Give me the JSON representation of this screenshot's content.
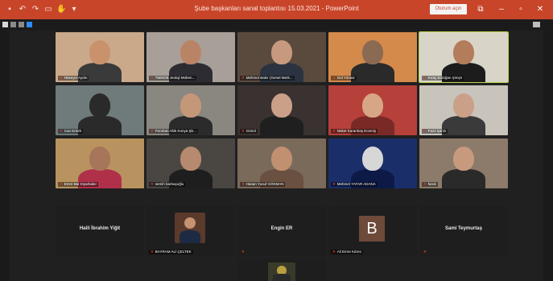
{
  "titlebar": {
    "title": "Şube başkanları sanal toplantısı 15.03.2021 - PowerPoint",
    "signin": "Oturum açın",
    "quick": [
      "save-icon",
      "undo-icon",
      "redo-icon",
      "start-presentation-icon",
      "touch-mode-icon",
      "customize-icon"
    ],
    "window_controls": [
      "ribbon-options-icon",
      "minimize-icon",
      "maximize-icon",
      "close-icon"
    ],
    "bg": "#c8452a"
  },
  "participants": [
    {
      "name": "Hüseyin Aydın",
      "bg": "#c9a98a",
      "skin": "#c9926c",
      "shirt": "#3a3a3a"
    },
    {
      "name": "TMMOB Jeoloji Mühen...",
      "bg": "#a8a098",
      "skin": "#b98466",
      "shirt": "#2e2c33"
    },
    {
      "name": "Mehmet Bakır (Genel Merk...",
      "bg": "#5a4a3e",
      "skin": "#c79a7f",
      "shirt": "#2b3340"
    },
    {
      "name": "Gül Yılmaz",
      "bg": "#d48a4a",
      "skin": "#8a6a52",
      "shirt": "#2a2a2a"
    },
    {
      "name": "Kıraç Erdoğan Şimşir",
      "bg": "#d9d4c8",
      "skin": "#b37c5a",
      "shirt": "#1c1c1c",
      "active": true
    },
    {
      "name": "Can Ertürk",
      "bg": "#6f7a7a",
      "skin": "#2a2a2a",
      "shirt": "#2a2a2a"
    },
    {
      "name": "Feruhan Altık Konya Şb...",
      "bg": "#8a8680",
      "skin": "#c59779",
      "shirt": "#2b2b2b"
    },
    {
      "name": "Gönül",
      "bg": "#3a3230",
      "skin": "#caa088",
      "shirt": "#1f1f1f"
    },
    {
      "name": "Nüket Karanbaş Ecemiş",
      "bg": "#b6403a",
      "skin": "#d6a686",
      "shirt": "#7a2a26"
    },
    {
      "name": "Fazıl Şahin",
      "bg": "#c8c4bc",
      "skin": "#caa088",
      "shirt": "#3a3a3a"
    },
    {
      "name": "Emre Bal Diyarbakır",
      "bg": "#b8935f",
      "skin": "#a7755a",
      "shirt": "#b0304a"
    },
    {
      "name": "semih barbaşoğlu",
      "bg": "#4a4642",
      "skin": "#b68a6e",
      "shirt": "#1e1e1e"
    },
    {
      "name": "Hasan Yusuf GÖKMAN",
      "bg": "#7a6a5a",
      "skin": "#c09070",
      "shirt": "#6a5040"
    },
    {
      "name": "Mehmet YATAR ADANA",
      "bg": "#1a2e6a",
      "skin": "#d7d7d7",
      "shirt": "#0d1a48"
    },
    {
      "name": "faruk",
      "bg": "#8c7a6a",
      "skin": "#c79a7e",
      "shirt": "#2a2a2a"
    }
  ],
  "row4": {
    "halil": "Halil İbrahim Yiğit",
    "bayram": "BAYRAM ALİ ÇELTEK",
    "engin": "Engin ER",
    "ali": "Ali Emre Kıbrıs",
    "ali_letter": "B",
    "sami": "Sami Teymurtaş"
  },
  "mic_icon": "mic-muted-icon"
}
